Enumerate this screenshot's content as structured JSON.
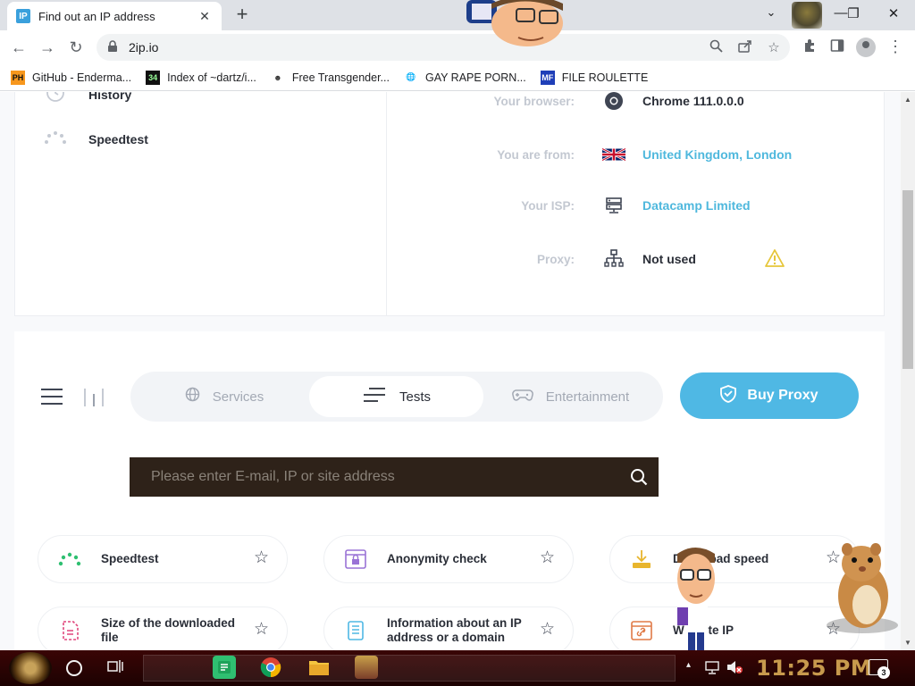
{
  "browser": {
    "tab": {
      "favicon": "IP",
      "title": "Find out an IP address",
      "close": "✕"
    },
    "new_tab": "+",
    "window_controls": {
      "minimize": "—",
      "restore": "❐",
      "close": "✕",
      "tab_search": "⌄"
    },
    "nav": {
      "back": "←",
      "forward": "→",
      "reload": "↻"
    },
    "url": "2ip.io",
    "bookmarks": [
      {
        "icon_text": "PH",
        "icon_bg": "#f7971d",
        "icon_color": "#111",
        "label": "GitHub - Enderma..."
      },
      {
        "icon_text": "34",
        "icon_bg": "#111",
        "icon_color": "#9f9",
        "label": "Index of ~dartz/i..."
      },
      {
        "icon_text": "☻",
        "icon_bg": "transparent",
        "icon_color": "#333",
        "label": "Free Transgender..."
      },
      {
        "icon_text": "🌐",
        "icon_bg": "transparent",
        "icon_color": "#333",
        "label": "GAY RAPE PORN..."
      },
      {
        "icon_text": "MF",
        "icon_bg": "#1f3fb8",
        "icon_color": "#fff",
        "label": "FILE ROULETTE"
      }
    ]
  },
  "sidebar": {
    "items": [
      {
        "label": "History",
        "icon": "clock-icon"
      },
      {
        "label": "Speedtest",
        "icon": "speedometer-icon"
      }
    ]
  },
  "info": {
    "rows": [
      {
        "label": "Your browser:",
        "value": "Chrome 111.0.0.0",
        "link": false,
        "icon": "chrome-icon"
      },
      {
        "label": "You are from:",
        "value": "United Kingdom, London",
        "link": true,
        "icon": "uk-flag-icon"
      },
      {
        "label": "Your ISP:",
        "value": "Datacamp Limited",
        "link": true,
        "icon": "server-icon"
      },
      {
        "label": "Proxy:",
        "value": "Not used",
        "link": false,
        "icon": "network-icon"
      }
    ]
  },
  "tabs": {
    "items": [
      {
        "label": "Services",
        "icon": "globe-icon",
        "active": false
      },
      {
        "label": "Tests",
        "icon": "sliders-icon",
        "active": true
      },
      {
        "label": "Entertainment",
        "icon": "gamepad-icon",
        "active": false
      }
    ],
    "buy_proxy": "Buy Proxy"
  },
  "search": {
    "placeholder": "Please enter E-mail, IP or site address",
    "value": ""
  },
  "tiles": [
    {
      "label": "Speedtest",
      "icon": "speedometer-icon",
      "color": "#2fbf71"
    },
    {
      "label": "Anonymity check",
      "icon": "browser-lock-icon",
      "color": "#9a73d6"
    },
    {
      "label": "Download speed",
      "icon": "download-icon",
      "color": "#e8b52d"
    },
    {
      "label": "Size of the downloaded file",
      "icon": "file-size-icon",
      "color": "#e0457b"
    },
    {
      "label": "Information about an IP address or a domain",
      "icon": "document-icon",
      "color": "#4fb8e4"
    },
    {
      "label": "Website IP",
      "icon": "browser-link-icon",
      "color": "#e07a47"
    }
  ],
  "taskbar": {
    "clock": "11:25 PM",
    "notifications": "3"
  },
  "colors": {
    "accent": "#4fb8e4",
    "text_dark": "#2a2e37",
    "label_muted": "#c3c8d1",
    "taskbar": "#2a0303",
    "clock": "#c79a4d"
  }
}
